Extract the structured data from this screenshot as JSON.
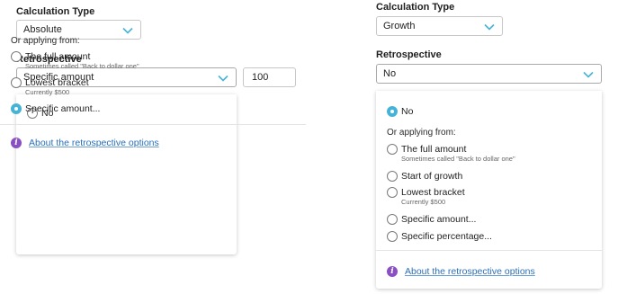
{
  "left": {
    "calc_label": "Calculation Type",
    "calc_value": "Absolute",
    "retro_label": "Retrospective",
    "retro_value": "Specific amount",
    "amount_value": "100",
    "options": [
      {
        "label": "No",
        "sub": "",
        "selected": false
      },
      {
        "label": "The full amount",
        "sub": "Sometimes called \"Back to dollar one\"",
        "selected": false
      },
      {
        "label": "Lowest bracket",
        "sub": "Currently $500",
        "selected": false
      },
      {
        "label": "Specific amount...",
        "sub": "",
        "selected": true
      }
    ],
    "or_label": "Or applying from:",
    "about_link": "About the retrospective options"
  },
  "right": {
    "calc_label": "Calculation Type",
    "calc_value": "Growth",
    "retro_label": "Retrospective",
    "retro_value": "No",
    "options": [
      {
        "label": "No",
        "sub": "",
        "selected": true
      },
      {
        "label": "The full amount",
        "sub": "Sometimes called \"Back to dollar one\"",
        "selected": false
      },
      {
        "label": "Start of growth",
        "sub": "",
        "selected": false
      },
      {
        "label": "Lowest bracket",
        "sub": "Currently $500",
        "selected": false
      },
      {
        "label": "Specific amount...",
        "sub": "",
        "selected": false
      },
      {
        "label": "Specific percentage...",
        "sub": "",
        "selected": false
      }
    ],
    "or_label": "Or applying from:",
    "about_link": "About the retrospective options"
  },
  "colors": {
    "accent": "#45b3d6",
    "info_icon": "#8a4fc2",
    "link": "#2a6fb8"
  },
  "icons": {
    "dropdown": "chevron-down-icon",
    "info": "info-icon"
  }
}
